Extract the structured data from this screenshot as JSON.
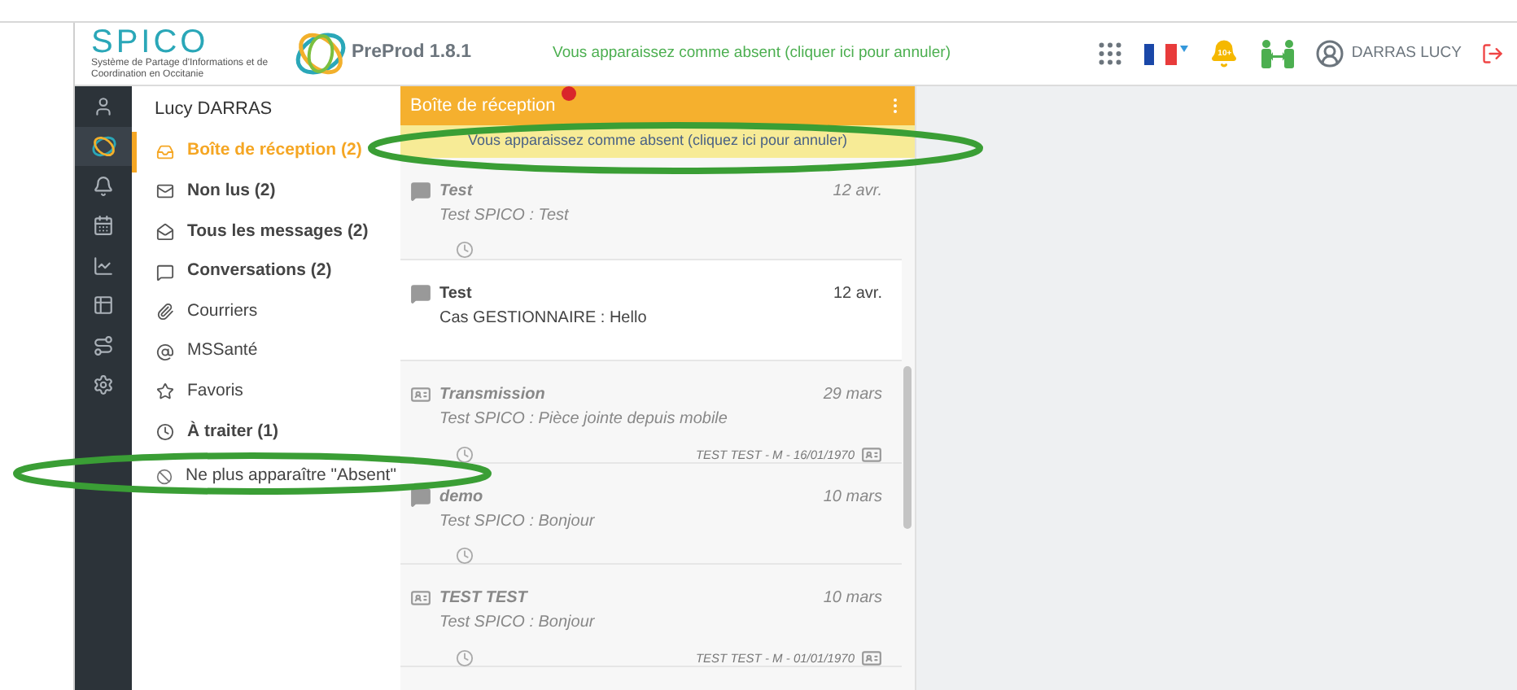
{
  "header": {
    "logo_text": "SPICO",
    "logo_subtitle": "Système de Partage d'Informations et de Coordination en Occitanie",
    "version": "PreProd 1.8.1",
    "absent_notice": "Vous apparaissez comme absent (cliquer ici pour annuler)",
    "notification_badge": "10+",
    "user_name": "DARRAS LUCY"
  },
  "menu": {
    "user": "Lucy DARRAS",
    "items": [
      {
        "label": "Boîte de réception (2)",
        "selected": true,
        "emphasized": true
      },
      {
        "label": "Non lus (2)",
        "selected": false,
        "emphasized": true
      },
      {
        "label": "Tous les messages (2)",
        "selected": false,
        "emphasized": true
      },
      {
        "label": "Conversations (2)",
        "selected": false,
        "emphasized": true
      },
      {
        "label": "Courriers",
        "selected": false,
        "emphasized": false
      },
      {
        "label": "MSSanté",
        "selected": false,
        "emphasized": false
      },
      {
        "label": "Favoris",
        "selected": false,
        "emphasized": false
      },
      {
        "label": "À traiter (1)",
        "selected": false,
        "emphasized": true
      }
    ],
    "absent_action": "Ne plus apparaître \"Absent\""
  },
  "inbox": {
    "title": "Boîte de réception",
    "banner": "Vous apparaissez comme absent (cliquez ici pour annuler)",
    "messages": [
      {
        "kind": "conversation",
        "title": "Test",
        "date": "12 avr.",
        "preview": "Test SPICO : Test",
        "read": true,
        "pending": true
      },
      {
        "kind": "conversation",
        "title": "Test",
        "date": "12 avr.",
        "preview": "Cas GESTIONNAIRE : Hello",
        "read": false,
        "pending": false
      },
      {
        "kind": "transmission",
        "title": "Transmission",
        "date": "29 mars",
        "preview": "Test SPICO : Pièce jointe depuis mobile",
        "read": true,
        "pending": true,
        "patient": "TEST TEST - M - 16/01/1970"
      },
      {
        "kind": "conversation",
        "title": "demo",
        "date": "10 mars",
        "preview": "Test SPICO : Bonjour",
        "read": true,
        "pending": true
      },
      {
        "kind": "transmission",
        "title": "TEST TEST",
        "date": "10 mars",
        "preview": "Test SPICO : Bonjour",
        "read": true,
        "pending": true,
        "patient": "TEST TEST - M - 01/01/1970"
      }
    ]
  }
}
